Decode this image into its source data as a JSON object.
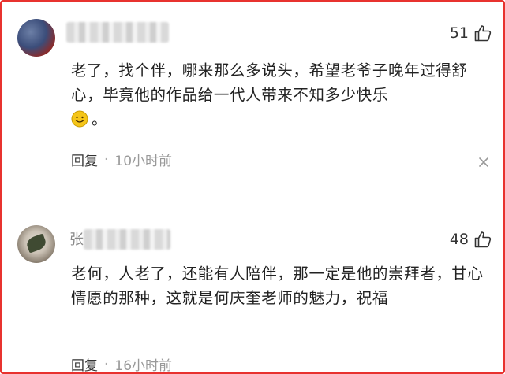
{
  "comments": [
    {
      "username_hidden": "",
      "likes": "51",
      "text": "老了，找个伴，哪来那么多说头，希望老爷子晚年过得舒心，毕竟他的作品给一代人带来不知多少快乐",
      "emoji": "slightly-smiling-face-icon",
      "text_suffix": "。",
      "reply_label": "回复",
      "separator": "·",
      "time": "10小时前"
    },
    {
      "username_prefix": "张",
      "likes": "48",
      "text": "老何，人老了，还能有人陪伴，那一定是他的崇拜者，甘心情愿的那种，这就是何庆奎老师的魅力，祝福",
      "reply_label": "回复",
      "separator": "·",
      "time": "16小时前"
    }
  ],
  "colors": {
    "frame_border": "#e8322f",
    "emoji_face": "#f5c518"
  }
}
